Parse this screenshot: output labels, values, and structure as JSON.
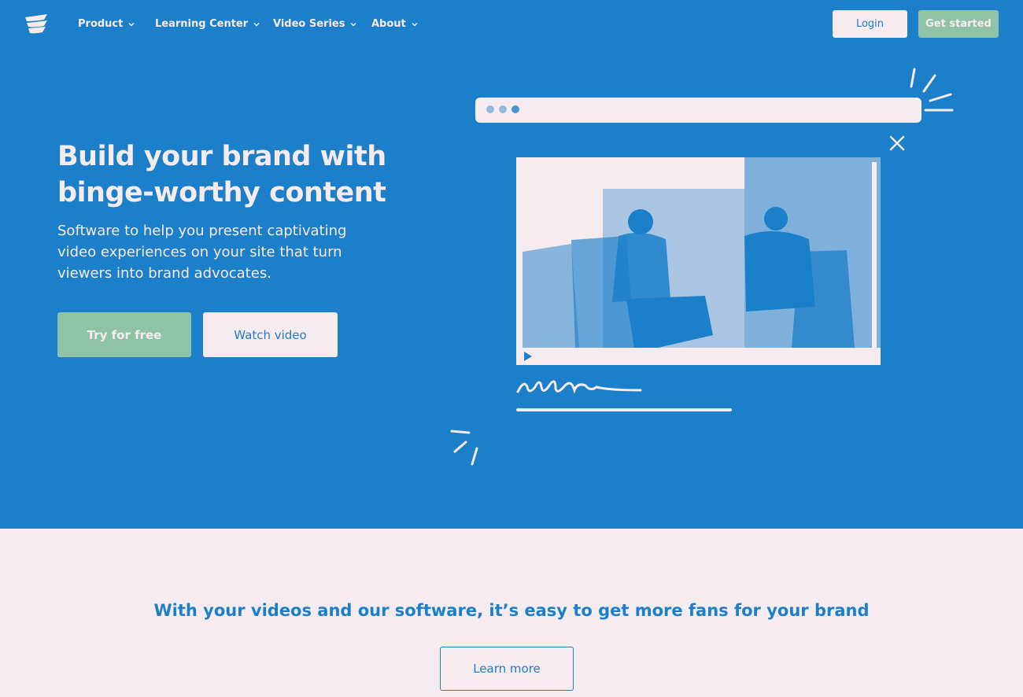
{
  "nav": {
    "items": [
      {
        "label": "Product"
      },
      {
        "label": "Learning Center"
      },
      {
        "label": "Video Series"
      },
      {
        "label": "About"
      }
    ],
    "login_label": "Login",
    "get_started_label": "Get started"
  },
  "hero": {
    "title": "Build your brand with binge-worthy content",
    "subtitle": "Software to help you present captivating video experiences on your site that turn viewers into brand advocates.",
    "primary_cta": "Try for free",
    "secondary_cta": "Watch video"
  },
  "section": {
    "tagline": "With your videos and our software, it’s easy to get more fans for your brand",
    "cta": "Learn more"
  },
  "colors": {
    "brand_blue": "#1b7fca",
    "pink_bg": "#f6ebef",
    "green_accent": "#8fc3a7"
  },
  "icons": [
    "logo-icon",
    "chevron-down-icon",
    "close-icon",
    "play-icon"
  ]
}
